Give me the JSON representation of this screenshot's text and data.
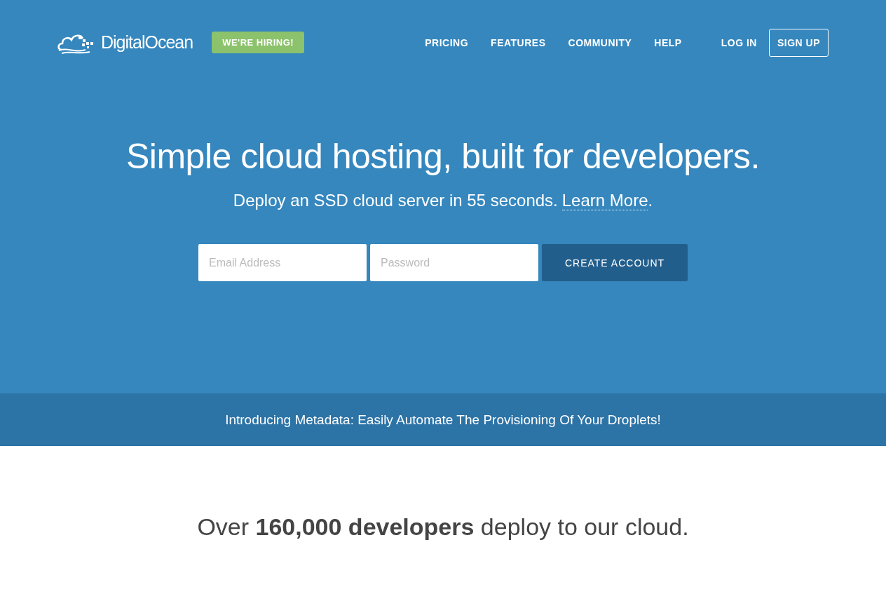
{
  "header": {
    "logo": "DigitalOcean",
    "hiring_badge": "WE'RE HIRING!",
    "nav": [
      {
        "label": "PRICING"
      },
      {
        "label": "FEATURES"
      },
      {
        "label": "COMMUNITY"
      },
      {
        "label": "HELP"
      }
    ],
    "login": "LOG IN",
    "signup": "SIGN UP"
  },
  "hero": {
    "title": "Simple cloud hosting, built for developers.",
    "subtitle": "Deploy an SSD cloud server in 55 seconds.",
    "learn_more": "Learn More",
    "period": ".",
    "email": {
      "placeholder": "Email Address"
    },
    "password": {
      "placeholder": "Password"
    },
    "button": "CREATE ACCOUNT"
  },
  "announcement": "Introducing Metadata: Easily Automate The Provisioning Of Your Droplets!",
  "stats": "Over **160,000 developers** deploy to our cloud."
}
